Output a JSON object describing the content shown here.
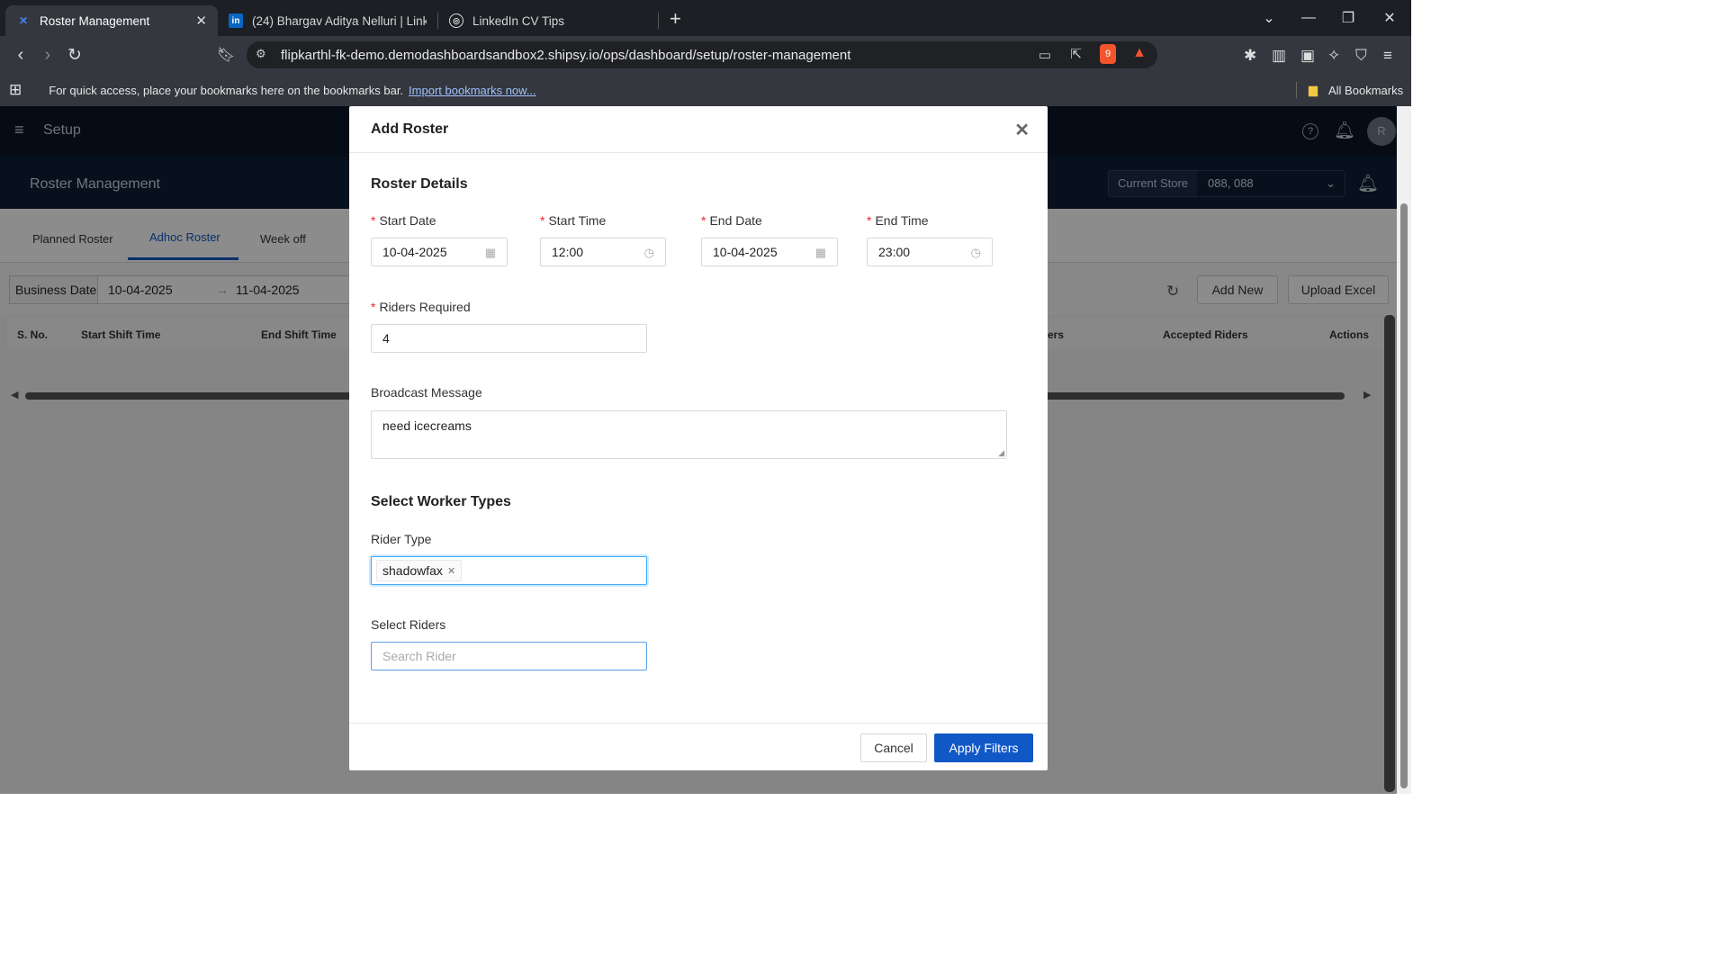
{
  "browser": {
    "tabs": [
      {
        "title": "Roster Management",
        "icon": "x-logo-icon"
      },
      {
        "title": "(24) Bhargav Aditya Nelluri | LinkedIn",
        "icon": "linkedin-icon"
      },
      {
        "title": "LinkedIn CV Tips",
        "icon": "openai-icon"
      }
    ],
    "url": "flipkarthl-fk-demo.demodashboardsandbox2.shipsy.io/ops/dashboard/setup/roster-management",
    "bookmarks_prompt": "For quick access, place your bookmarks here on the bookmarks bar.",
    "import_link": "Import bookmarks now...",
    "all_bookmarks": "All Bookmarks",
    "brave_badge": "9"
  },
  "app": {
    "header_title": "Setup",
    "avatar_letter": "R",
    "page_title": "Roster Management",
    "store_label": "Current Store",
    "store_value": "088, 088",
    "tabs": [
      "Planned Roster",
      "Adhoc Roster",
      "Week off"
    ],
    "filter_label": "Business Date",
    "filter_from": "10-04-2025",
    "filter_to": "11-04-2025",
    "add_new": "Add New",
    "upload_excel": "Upload Excel",
    "columns": [
      "S. No.",
      "Start Shift Time",
      "End Shift Time",
      "ers",
      "Accepted Riders",
      "Actions"
    ]
  },
  "modal": {
    "title": "Add Roster",
    "roster_details": "Roster Details",
    "start_date_label": "Start Date",
    "start_date": "10-04-2025",
    "start_time_label": "Start Time",
    "start_time": "12:00",
    "end_date_label": "End Date",
    "end_date": "10-04-2025",
    "end_time_label": "End Time",
    "end_time": "23:00",
    "riders_required_label": "Riders Required",
    "riders_required": "4",
    "broadcast_label": "Broadcast Message",
    "broadcast_message": "need icecreams",
    "worker_types": "Select Worker Types",
    "rider_type_label": "Rider Type",
    "rider_type_tag": "shadowfax",
    "select_riders_label": "Select Riders",
    "search_placeholder": "Search Rider",
    "cancel": "Cancel",
    "apply": "Apply Filters"
  }
}
